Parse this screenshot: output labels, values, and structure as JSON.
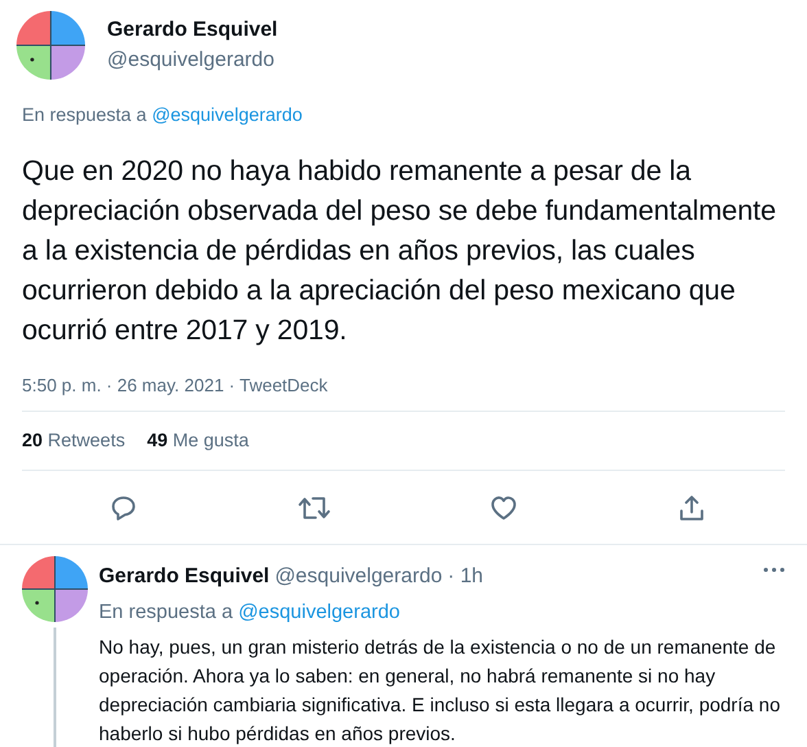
{
  "main_tweet": {
    "author": "Gerardo Esquivel",
    "handle": "@esquivelgerardo",
    "reply_label": "En respuesta a",
    "reply_to": "@esquivelgerardo",
    "text": "Que en 2020 no haya habido remanente a pesar de la depreciación observada del peso se debe fundamentalmente a la existencia de pérdidas en años previos, las cuales ocurrieron debido a la apreciación del peso mexicano que ocurrió entre 2017 y 2019.",
    "timestamp": "5:50 p. m. · 26 may. 2021 · TweetDeck",
    "stats": [
      {
        "count": "20",
        "label": "Retweets"
      },
      {
        "count": "49",
        "label": "Me gusta"
      }
    ]
  },
  "reply": {
    "author": "Gerardo Esquivel",
    "handle": "@esquivelgerardo",
    "time": "· 1h",
    "reply_label": "En respuesta a",
    "reply_to": "@esquivelgerardo",
    "text": "No hay, pues, un gran misterio detrás de la existencia o no de un remanente de operación. Ahora ya lo saben: en general, no habrá remanente si no hay depreciación cambiaria significativa. E incluso si esta llegara a ocurrir, podría no haberlo si hubo pérdidas en años previos."
  }
}
